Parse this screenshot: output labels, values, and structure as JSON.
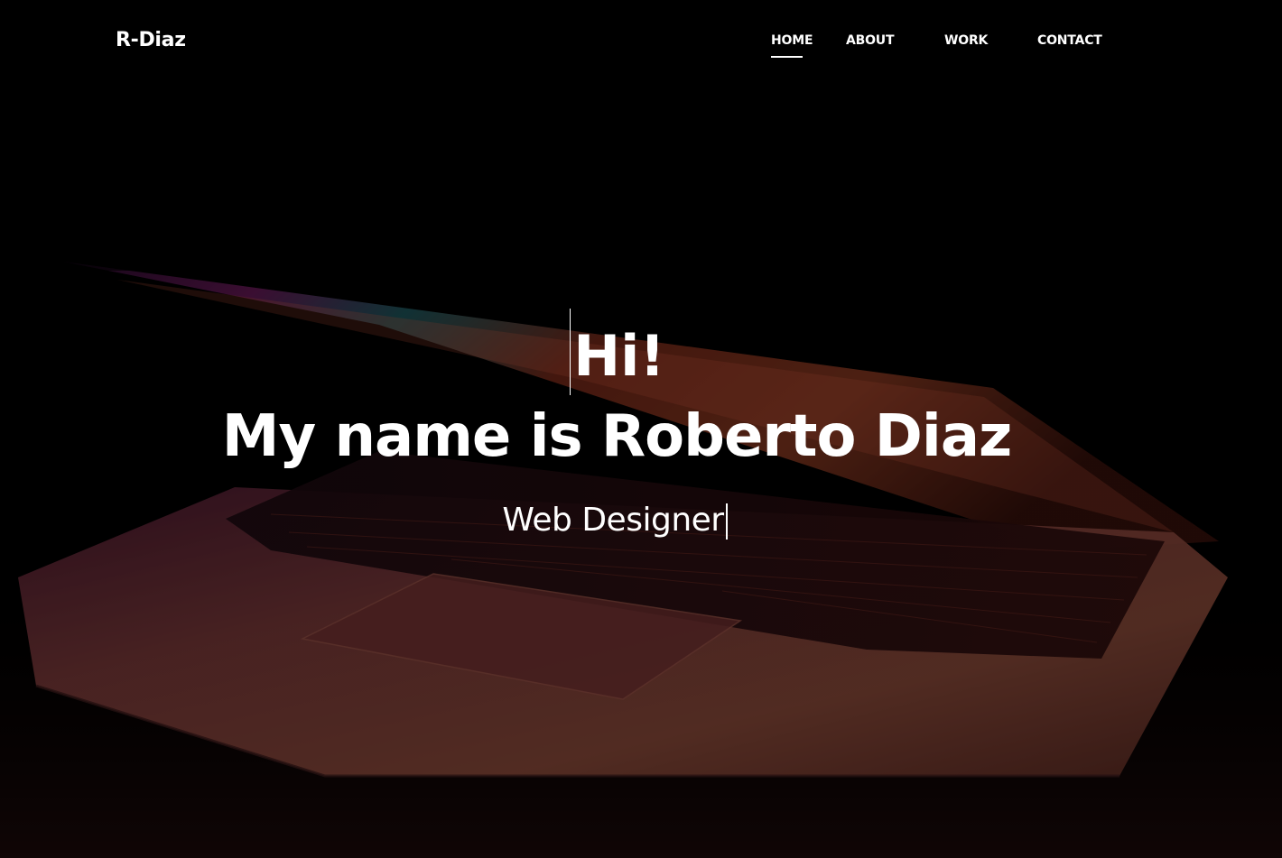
{
  "site": {
    "brand": "R-Diaz"
  },
  "nav": {
    "items": [
      {
        "label": "HOME",
        "active": true
      },
      {
        "label": "ABOUT",
        "active": false
      },
      {
        "label": "WORK",
        "active": false
      },
      {
        "label": "CONTACT",
        "active": false
      }
    ]
  },
  "hero": {
    "greeting": "Hi!",
    "headline": "My name is Roberto Diaz",
    "role": "Web Designer",
    "background_image": "laptop-photo"
  },
  "colors": {
    "background": "#000000",
    "text": "#ffffff"
  }
}
